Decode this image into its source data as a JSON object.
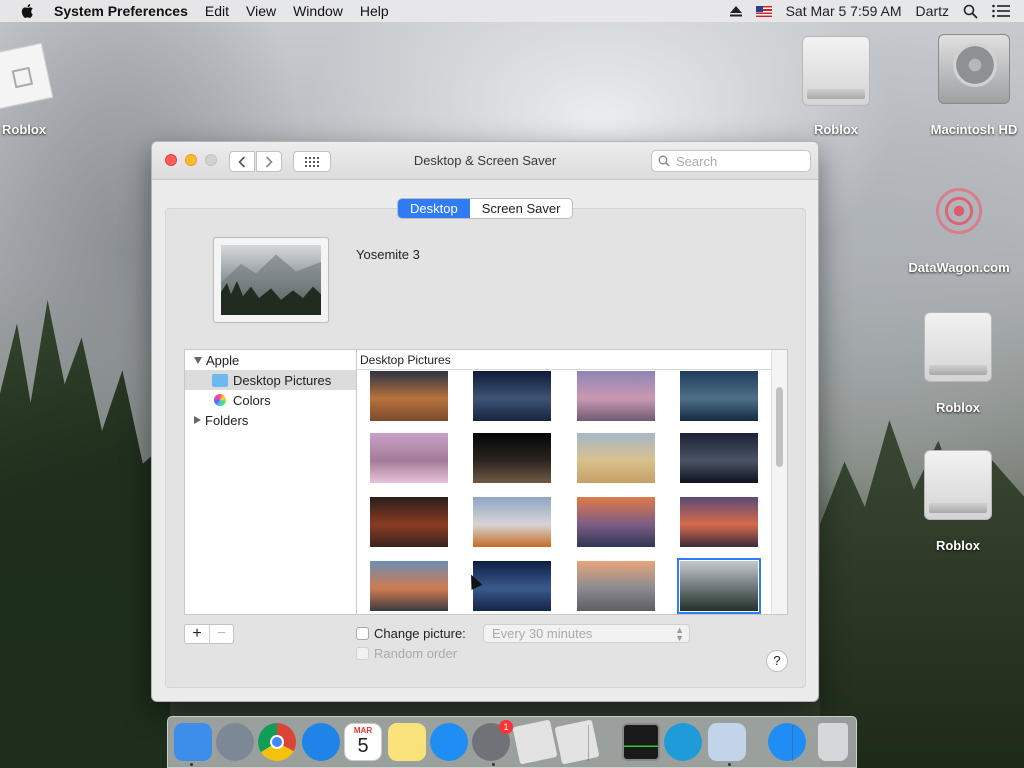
{
  "menubar": {
    "app_name": "System Preferences",
    "items": [
      "Edit",
      "View",
      "Window",
      "Help"
    ],
    "clock": "Sat Mar 5  7:59 AM",
    "user": "Dartz"
  },
  "desktop_icons": {
    "roblox_app": "Roblox",
    "drive1": "Roblox",
    "macintosh_hd": "Macintosh HD",
    "datawagon": "DataWagon.com",
    "drive2": "Roblox",
    "drive3": "Roblox"
  },
  "window": {
    "title": "Desktop & Screen Saver",
    "search_placeholder": "Search",
    "tabs": [
      {
        "label": "Desktop",
        "active": true
      },
      {
        "label": "Screen Saver",
        "active": false
      }
    ],
    "current_picture_name": "Yosemite 3",
    "sidebar": {
      "apple": "Apple",
      "desktop_pictures": "Desktop Pictures",
      "colors": "Colors",
      "folders": "Folders"
    },
    "grid_header": "Desktop Pictures",
    "thumbnails": [
      {
        "colors": [
          "#2d3444",
          "#b8723d",
          "#7a4b2b"
        ],
        "selected": false
      },
      {
        "colors": [
          "#0e1c36",
          "#3e5477",
          "#17243d"
        ],
        "selected": false
      },
      {
        "colors": [
          "#8f84b4",
          "#c999b1",
          "#6f5a73"
        ],
        "selected": false
      },
      {
        "colors": [
          "#1f3b5c",
          "#4f6f88",
          "#162a40"
        ],
        "selected": false
      },
      {
        "colors": [
          "#c8a1c9",
          "#a47b97",
          "#e7c3d8"
        ],
        "selected": false
      },
      {
        "colors": [
          "#050505",
          "#2b2420",
          "#705a45"
        ],
        "selected": false
      },
      {
        "colors": [
          "#a6b7c8",
          "#d9c08c",
          "#c4a066"
        ],
        "selected": false
      },
      {
        "colors": [
          "#1b2235",
          "#4b5466",
          "#0f131f"
        ],
        "selected": false
      },
      {
        "colors": [
          "#2a1d1b",
          "#8a3b24",
          "#3a2420"
        ],
        "selected": false
      },
      {
        "colors": [
          "#8fa6c4",
          "#d7d5d5",
          "#c56c25"
        ],
        "selected": false
      },
      {
        "colors": [
          "#e17a48",
          "#7c5d86",
          "#2f3654"
        ],
        "selected": false
      },
      {
        "colors": [
          "#5b4a78",
          "#d66b4a",
          "#3b2a3d"
        ],
        "selected": false
      },
      {
        "colors": [
          "#6d8fb4",
          "#cf7a50",
          "#3c3a40"
        ],
        "selected": false
      },
      {
        "colors": [
          "#0e1f45",
          "#3a5a8c",
          "#142447"
        ],
        "selected": false
      },
      {
        "colors": [
          "#e8a67d",
          "#8a8a8f",
          "#5d5f66"
        ],
        "selected": false
      },
      {
        "colors": [
          "#c4c9cd",
          "#6b7377",
          "#213127"
        ],
        "selected": true
      }
    ],
    "add_label": "+",
    "remove_label": "−",
    "change_picture": {
      "label": "Change picture:",
      "checked": false
    },
    "interval": "Every 30 minutes",
    "random_order": {
      "label": "Random order",
      "checked": false,
      "enabled": false
    },
    "help": "?"
  },
  "dock": {
    "items": [
      {
        "name": "finder",
        "color": "#3d8eea"
      },
      {
        "name": "launchpad",
        "color": "#7d8896"
      },
      {
        "name": "chrome",
        "color": "#f0f0f0"
      },
      {
        "name": "safari",
        "color": "#1f83e8"
      },
      {
        "name": "calendar",
        "color": "#ffffff"
      },
      {
        "name": "notes",
        "color": "#f9e27c"
      },
      {
        "name": "app-store",
        "color": "#1f8df4"
      },
      {
        "name": "system-preferences",
        "color": "#6f7378"
      },
      {
        "name": "roblox-1",
        "color": "#e3e3e3"
      },
      {
        "name": "roblox-2",
        "color": "#e3e3e3"
      },
      {
        "name": "activity-monitor",
        "color": "#1a1a1a"
      },
      {
        "name": "edge",
        "color": "#1f9bd9"
      },
      {
        "name": "preview",
        "color": "#c2d4ea"
      },
      {
        "name": "app-store-downloads",
        "color": "#1f8df4"
      },
      {
        "name": "trash",
        "color": "#d5d8db"
      }
    ],
    "calendar_month": "MAR",
    "calendar_day": "5",
    "system_prefs_badge": "1"
  }
}
